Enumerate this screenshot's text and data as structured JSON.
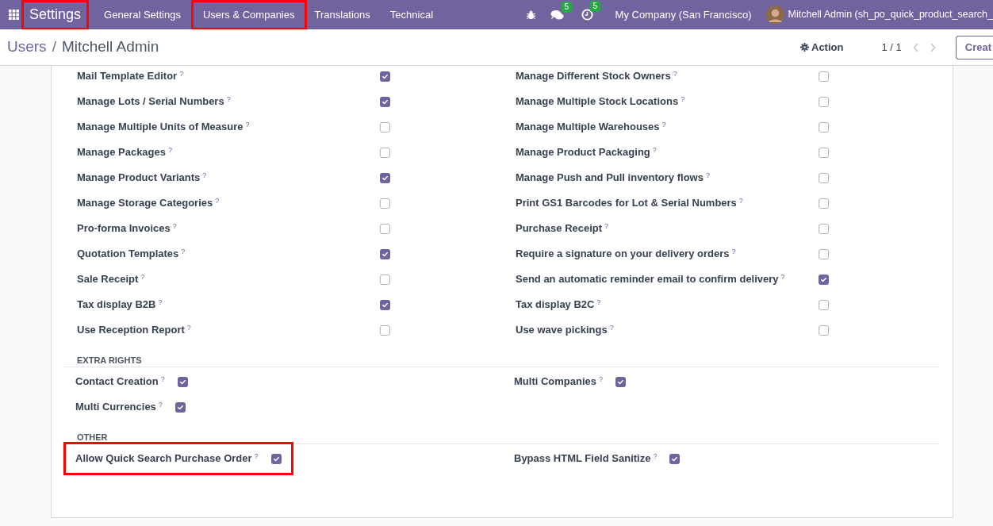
{
  "navbar": {
    "app_name": "Settings",
    "app_highlighted": true,
    "menus": [
      {
        "label": "General Settings",
        "highlighted": false
      },
      {
        "label": "Users & Companies",
        "highlighted": true
      },
      {
        "label": "Translations",
        "highlighted": false
      },
      {
        "label": "Technical",
        "highlighted": false
      }
    ],
    "messages_count": "5",
    "activities_count": "5",
    "company": "My Company (San Francisco)",
    "user": "Mitchell Admin (sh_po_quick_product_search_"
  },
  "control_panel": {
    "breadcrumb": [
      {
        "label": "Users",
        "link": true
      },
      {
        "label": "Mitchell Admin",
        "link": false
      }
    ],
    "separator": "/",
    "action": "Action",
    "pager": "1 / 1",
    "create_button": "Creat"
  },
  "rights": [
    {
      "label": "Mail Template Editor",
      "help": "?",
      "checked": true
    },
    {
      "label": "Manage Different Stock Owners",
      "help": "?",
      "checked": false
    },
    {
      "label": "Manage Lots / Serial Numbers",
      "help": "?",
      "checked": true
    },
    {
      "label": "Manage Multiple Stock Locations",
      "help": "?",
      "checked": false
    },
    {
      "label": "Manage Multiple Units of Measure",
      "help": "?",
      "checked": false
    },
    {
      "label": "Manage Multiple Warehouses",
      "help": "?",
      "checked": false
    },
    {
      "label": "Manage Packages",
      "help": "?",
      "checked": false
    },
    {
      "label": "Manage Product Packaging",
      "help": "?",
      "checked": false
    },
    {
      "label": "Manage Product Variants",
      "help": "?",
      "checked": true
    },
    {
      "label": "Manage Push and Pull inventory flows",
      "help": "?",
      "checked": false
    },
    {
      "label": "Manage Storage Categories",
      "help": "?",
      "checked": false
    },
    {
      "label": "Print GS1 Barcodes for Lot & Serial Numbers",
      "help": "?",
      "checked": false
    },
    {
      "label": "Pro-forma Invoices",
      "help": "?",
      "checked": false
    },
    {
      "label": "Purchase Receipt",
      "help": "?",
      "checked": false
    },
    {
      "label": "Quotation Templates",
      "help": "?",
      "checked": true
    },
    {
      "label": "Require a signature on your delivery orders",
      "help": "?",
      "checked": false
    },
    {
      "label": "Sale Receipt",
      "help": "?",
      "checked": false
    },
    {
      "label": "Send an automatic reminder email to confirm delivery",
      "help": "?",
      "checked": true
    },
    {
      "label": "Tax display B2B",
      "help": "?",
      "checked": true
    },
    {
      "label": "Tax display B2C",
      "help": "?",
      "checked": false
    },
    {
      "label": "Use Reception Report",
      "help": "?",
      "checked": false
    },
    {
      "label": "Use wave pickings",
      "help": "?",
      "checked": false
    }
  ],
  "sections": [
    {
      "title": "EXTRA RIGHTS",
      "items": [
        {
          "label": "Contact Creation",
          "help": "?",
          "checked": true,
          "highlighted": false
        },
        {
          "label": "Multi Companies",
          "help": "?",
          "checked": true,
          "highlighted": false
        },
        {
          "label": "Multi Currencies",
          "help": "?",
          "checked": true,
          "highlighted": false
        }
      ]
    },
    {
      "title": "OTHER",
      "items": [
        {
          "label": "Allow Quick Search Purchase Order",
          "help": "?",
          "checked": true,
          "highlighted": true
        },
        {
          "label": "Bypass HTML Field Sanitize",
          "help": "?",
          "checked": true,
          "highlighted": false
        }
      ]
    }
  ]
}
